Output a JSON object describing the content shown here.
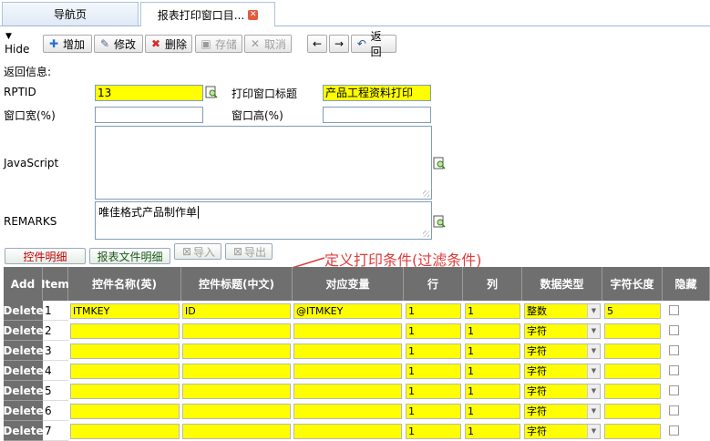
{
  "tabs": [
    {
      "label": "导航页"
    },
    {
      "label": "报表打印窗口目..."
    }
  ],
  "toolbar": {
    "hide": "Hide",
    "add": "增加",
    "edit": "修改",
    "delete": "删除",
    "save": "存储",
    "cancel": "取消",
    "return": "返回"
  },
  "form": {
    "return_info": "返回信息:",
    "rptid_label": "RPTID",
    "rptid_value": "13",
    "title_label": "打印窗口标题",
    "title_value": "产品工程资料打印",
    "width_label": "窗口宽(%)",
    "width_value": "",
    "height_label": "窗口高(%)",
    "height_value": "",
    "js_label": "JavaScript",
    "js_value": "",
    "remarks_label": "REMARKS",
    "remarks_value": "唯佳格式产品制作单"
  },
  "subtabs": {
    "controls": "控件明细",
    "report_files": "报表文件明细",
    "import": "导入",
    "export": "导出"
  },
  "annotation": "定义打印条件(过滤条件)",
  "grid": {
    "headers": {
      "add": "Add",
      "item": "Item",
      "name_en": "控件名称(英)",
      "title_cn": "控件标题(中文)",
      "variable": "对应变量",
      "row": "行",
      "col": "列",
      "dtype": "数据类型",
      "length": "字符长度",
      "hidden": "隐藏"
    },
    "delete_label": "Delete",
    "rows": [
      {
        "item": "1",
        "name_en": "ITMKEY",
        "title_cn": "ID",
        "variable": "@ITMKEY",
        "row": "1",
        "col": "1",
        "dtype": "整数",
        "length": "5"
      },
      {
        "item": "2",
        "name_en": "",
        "title_cn": "",
        "variable": "",
        "row": "1",
        "col": "1",
        "dtype": "字符",
        "length": ""
      },
      {
        "item": "3",
        "name_en": "",
        "title_cn": "",
        "variable": "",
        "row": "1",
        "col": "1",
        "dtype": "字符",
        "length": ""
      },
      {
        "item": "4",
        "name_en": "",
        "title_cn": "",
        "variable": "",
        "row": "1",
        "col": "1",
        "dtype": "字符",
        "length": ""
      },
      {
        "item": "5",
        "name_en": "",
        "title_cn": "",
        "variable": "",
        "row": "1",
        "col": "1",
        "dtype": "字符",
        "length": ""
      },
      {
        "item": "6",
        "name_en": "",
        "title_cn": "",
        "variable": "",
        "row": "1",
        "col": "1",
        "dtype": "字符",
        "length": ""
      },
      {
        "item": "7",
        "name_en": "",
        "title_cn": "",
        "variable": "",
        "row": "1",
        "col": "1",
        "dtype": "字符",
        "length": ""
      }
    ]
  },
  "colors": {
    "field_highlight": "#ffff00",
    "grid_header": "#6f6f6f",
    "annotation": "#e03a3a"
  }
}
